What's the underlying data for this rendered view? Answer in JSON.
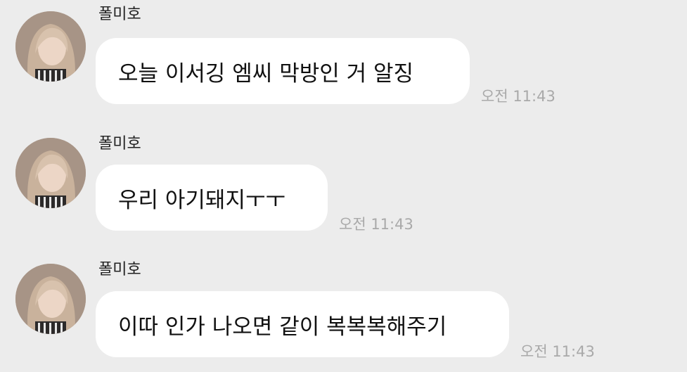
{
  "messages": [
    {
      "sender": "폴미호",
      "text": "오늘 이서깅 엠씨 막방인 거 알징",
      "time": "오전 11:43"
    },
    {
      "sender": "폴미호",
      "text": "우리 아기돼지ㅜㅜ",
      "time": "오전 11:43"
    },
    {
      "sender": "폴미호",
      "text": "이따 인가 나오면 같이 복복복해주기",
      "time": "오전 11:43"
    }
  ],
  "colors": {
    "background": "#ececec",
    "bubble": "#ffffff",
    "time_text": "#a9a9a9"
  },
  "icons": {
    "avatar": "profile-photo"
  }
}
